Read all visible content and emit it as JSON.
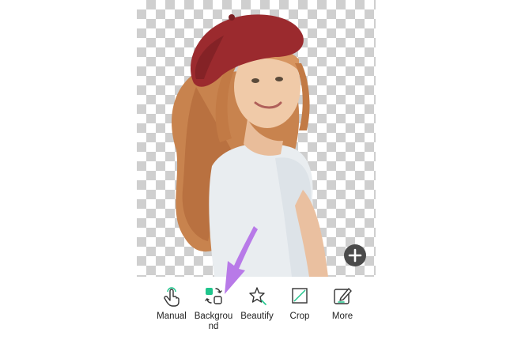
{
  "canvas": {
    "background": "transparent-checkerboard",
    "add_button_icon": "plus-icon"
  },
  "toolbar": {
    "items": [
      {
        "label": "Manual",
        "icon": "hand-pointer-icon"
      },
      {
        "label": "Background",
        "icon": "background-swap-icon",
        "accent": "#1fc58c"
      },
      {
        "label": "Beautify",
        "icon": "sparkle-star-icon"
      },
      {
        "label": "Crop",
        "icon": "crop-icon"
      },
      {
        "label": "More",
        "icon": "edit-pencil-icon"
      }
    ]
  },
  "annotation": {
    "color": "#b87ae8",
    "points_to": "Background"
  }
}
